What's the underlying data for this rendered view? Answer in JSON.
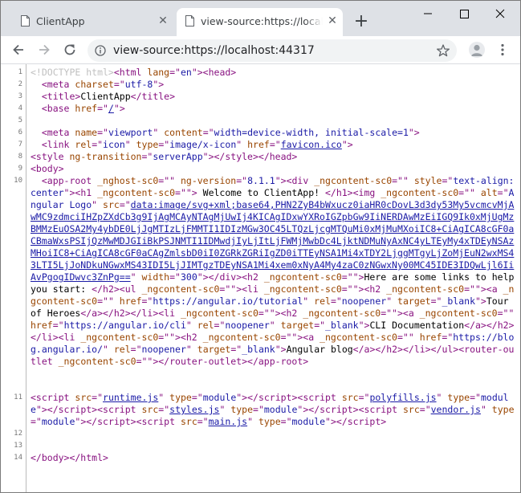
{
  "tabs": [
    {
      "title": "ClientApp",
      "active": false
    },
    {
      "title": "view-source:https://localhost",
      "active": true
    }
  ],
  "toolbar": {
    "url": "view-source:https://localhost:44317"
  },
  "source_lines": [
    {
      "num": "1",
      "html": "<span class=\"c-doc\">&lt;!DOCTYPE html&gt;</span><span class=\"c-tag\">&lt;html </span><span class=\"c-attr\">lang</span><span class=\"c-tag\">=\"</span><span class=\"c-val\">en</span><span class=\"c-tag\">\"&gt;&lt;head&gt;</span>"
    },
    {
      "num": "2",
      "html": "  <span class=\"c-tag\">&lt;meta </span><span class=\"c-attr\">charset</span><span class=\"c-tag\">=\"</span><span class=\"c-val\">utf-8</span><span class=\"c-tag\">\"&gt;</span>"
    },
    {
      "num": "3",
      "html": "  <span class=\"c-tag\">&lt;title&gt;</span>ClientApp<span class=\"c-tag\">&lt;/title&gt;</span>"
    },
    {
      "num": "4",
      "html": "  <span class=\"c-tag\">&lt;base </span><span class=\"c-attr\">href</span><span class=\"c-tag\">=\"</span><span class=\"c-link\">/</span><span class=\"c-tag\">\"&gt;</span>"
    },
    {
      "num": "5",
      "html": ""
    },
    {
      "num": "6",
      "html": "  <span class=\"c-tag\">&lt;meta </span><span class=\"c-attr\">name</span><span class=\"c-tag\">=\"</span><span class=\"c-val\">viewport</span><span class=\"c-tag\">\" </span><span class=\"c-attr\">content</span><span class=\"c-tag\">=\"</span><span class=\"c-val\">width=device-width, initial-scale=1</span><span class=\"c-tag\">\"&gt;</span>"
    },
    {
      "num": "7",
      "html": "  <span class=\"c-tag\">&lt;link </span><span class=\"c-attr\">rel</span><span class=\"c-tag\">=\"</span><span class=\"c-val\">icon</span><span class=\"c-tag\">\" </span><span class=\"c-attr\">type</span><span class=\"c-tag\">=\"</span><span class=\"c-val\">image/x-icon</span><span class=\"c-tag\">\" </span><span class=\"c-attr\">href</span><span class=\"c-tag\">=\"</span><span class=\"c-link\">favicon.ico</span><span class=\"c-tag\">\"&gt;</span>"
    },
    {
      "num": "8",
      "html": "<span class=\"c-tag\">&lt;style </span><span class=\"c-attr\">ng-transition</span><span class=\"c-tag\">=\"</span><span class=\"c-val\">serverApp</span><span class=\"c-tag\">\"&gt;&lt;/style&gt;&lt;/head&gt;</span>"
    },
    {
      "num": "9",
      "html": "<span class=\"c-tag\">&lt;body&gt;</span>"
    },
    {
      "num": "10",
      "html": "  <span class=\"c-tag\">&lt;app-root </span><span class=\"c-attr\">_nghost-sc0</span><span class=\"c-tag\">=\"\" </span><span class=\"c-attr\">ng-version</span><span class=\"c-tag\">=\"</span><span class=\"c-val\">8.1.1</span><span class=\"c-tag\">\"&gt;&lt;div </span><span class=\"c-attr\">_ngcontent-sc0</span><span class=\"c-tag\">=\"\" </span><span class=\"c-attr\">style</span><span class=\"c-tag\">=\"</span><span class=\"c-val\">text-align:center</span><span class=\"c-tag\">\"&gt;&lt;h1 </span><span class=\"c-attr\">_ngcontent-sc0</span><span class=\"c-tag\">=\"\"&gt;</span> Welcome to ClientApp! <span class=\"c-tag\">&lt;/h1&gt;&lt;img </span><span class=\"c-attr\">_ngcontent-sc0</span><span class=\"c-tag\">=\"\" </span><span class=\"c-attr\">alt</span><span class=\"c-tag\">=\"</span><span class=\"c-val\">Angular Logo</span><span class=\"c-tag\">\" </span><span class=\"c-attr\">src</span><span class=\"c-tag\">=\"</span><span class=\"c-link\">data:image/svg+xml;base64,PHN2ZyB4bWxucz0iaHR0cDovL3d3dy53My5vcmcvMjAwMC9zdmciIHZpZXdCb3g9IjAgMCAyNTAgMjUwIj4KICAgIDxwYXRoIGZpbGw9IiNERDAwMzEiIGQ9Ik0xMjUgMzBMMzEuOSA2My4ybDE0LjJgMTIzLjFMMTI1IDIzMGw3OC45LTQzLjcgMTQuMi0xMjMuMXoiIC8+CiAgICA8cGF0aCBmaWxsPSIjQzMwMDJGIiBkPSJNMTI1IDMwdjIyLjItLjFWMjMwbDc4LjktNDMuNyAxNC4yLTEyMy4xTDEyNSAzMHoiIC8+CiAgICA8cGF0aCAgZmlsbD0iI0ZGRkZGRiIgZD0iTTEyNSA1Mi4xTDY2LjggMTgyLjZoMjEuN2wxMS43LTI5LjJoNDkuNGwxMS43IDI5LjJIMTgzTDEyNSA1Mi4xem0xNyA4My4zaC0zNGwxNy00MC45IDE3IDQwLjl6IiAvPgogIDwvc3ZnPg==</span><span class=\"c-tag\">\" </span><span class=\"c-attr\">width</span><span class=\"c-tag\">=\"</span><span class=\"c-val\">300</span><span class=\"c-tag\">\"&gt;&lt;/div&gt;&lt;h2 </span><span class=\"c-attr\">_ngcontent-sc0</span><span class=\"c-tag\">=\"\"&gt;</span>Here are some links to help you start: <span class=\"c-tag\">&lt;/h2&gt;&lt;ul </span><span class=\"c-attr\">_ngcontent-sc0</span><span class=\"c-tag\">=\"\"&gt;&lt;li </span><span class=\"c-attr\">_ngcontent-sc0</span><span class=\"c-tag\">=\"\"&gt;&lt;h2 </span><span class=\"c-attr\">_ngcontent-sc0</span><span class=\"c-tag\">=\"\"&gt;&lt;a </span><span class=\"c-attr\">_ngcontent-sc0</span><span class=\"c-tag\">=\"\" </span><span class=\"c-attr\">href</span><span class=\"c-tag\">=\"</span><span class=\"c-val\">https://angular.io/tutorial</span><span class=\"c-tag\">\" </span><span class=\"c-attr\">rel</span><span class=\"c-tag\">=\"</span><span class=\"c-val\">noopener</span><span class=\"c-tag\">\" </span><span class=\"c-attr\">target</span><span class=\"c-tag\">=\"</span><span class=\"c-val\">_blank</span><span class=\"c-tag\">\"&gt;</span>Tour of Heroes<span class=\"c-tag\">&lt;/a&gt;&lt;/h2&gt;&lt;/li&gt;&lt;li </span><span class=\"c-attr\">_ngcontent-sc0</span><span class=\"c-tag\">=\"\"&gt;&lt;h2 </span><span class=\"c-attr\">_ngcontent-sc0</span><span class=\"c-tag\">=\"\"&gt;&lt;a </span><span class=\"c-attr\">_ngcontent-sc0</span><span class=\"c-tag\">=\"\" </span><span class=\"c-attr\">href</span><span class=\"c-tag\">=\"</span><span class=\"c-val\">https://angular.io/cli</span><span class=\"c-tag\">\" </span><span class=\"c-attr\">rel</span><span class=\"c-tag\">=\"</span><span class=\"c-val\">noopener</span><span class=\"c-tag\">\" </span><span class=\"c-attr\">target</span><span class=\"c-tag\">=\"</span><span class=\"c-val\">_blank</span><span class=\"c-tag\">\"&gt;</span>CLI Documentation<span class=\"c-tag\">&lt;/a&gt;&lt;/h2&gt;&lt;/li&gt;&lt;li </span><span class=\"c-attr\">_ngcontent-sc0</span><span class=\"c-tag\">=\"\"&gt;&lt;h2 </span><span class=\"c-attr\">_ngcontent-sc0</span><span class=\"c-tag\">=\"\"&gt;&lt;a </span><span class=\"c-attr\">_ngcontent-sc0</span><span class=\"c-tag\">=\"\" </span><span class=\"c-attr\">href</span><span class=\"c-tag\">=\"</span><span class=\"c-val\">https://blog.angular.io/</span><span class=\"c-tag\">\" </span><span class=\"c-attr\">rel</span><span class=\"c-tag\">=\"</span><span class=\"c-val\">noopener</span><span class=\"c-tag\">\" </span><span class=\"c-attr\">target</span><span class=\"c-tag\">=\"</span><span class=\"c-val\">_blank</span><span class=\"c-tag\">\"&gt;</span>Angular blog<span class=\"c-tag\">&lt;/a&gt;&lt;/h2&gt;&lt;/li&gt;&lt;/ul&gt;&lt;router-outlet </span><span class=\"c-attr\">_ngcontent-sc0</span><span class=\"c-tag\">=\"\"&gt;&lt;/router-outlet&gt;&lt;/app-root&gt;</span>"
    },
    {
      "num": "11",
      "html": "<span class=\"c-tag\">&lt;script </span><span class=\"c-attr\">src</span><span class=\"c-tag\">=\"</span><span class=\"c-link\">runtime.js</span><span class=\"c-tag\">\" </span><span class=\"c-attr\">type</span><span class=\"c-tag\">=\"</span><span class=\"c-val\">module</span><span class=\"c-tag\">\"&gt;&lt;/script&gt;&lt;script </span><span class=\"c-attr\">src</span><span class=\"c-tag\">=\"</span><span class=\"c-link\">polyfills.js</span><span class=\"c-tag\">\" </span><span class=\"c-attr\">type</span><span class=\"c-tag\">=\"</span><span class=\"c-val\">module</span><span class=\"c-tag\">\"&gt;&lt;/script&gt;&lt;script </span><span class=\"c-attr\">src</span><span class=\"c-tag\">=\"</span><span class=\"c-link\">styles.js</span><span class=\"c-tag\">\" </span><span class=\"c-attr\">type</span><span class=\"c-tag\">=\"</span><span class=\"c-val\">module</span><span class=\"c-tag\">\"&gt;&lt;/script&gt;&lt;script </span><span class=\"c-attr\">src</span><span class=\"c-tag\">=\"</span><span class=\"c-link\">vendor.js</span><span class=\"c-tag\">\" </span><span class=\"c-attr\">type</span><span class=\"c-tag\">=\"</span><span class=\"c-val\">module</span><span class=\"c-tag\">\"&gt;&lt;/script&gt;&lt;script </span><span class=\"c-attr\">src</span><span class=\"c-tag\">=\"</span><span class=\"c-link\">main.js</span><span class=\"c-tag\">\" </span><span class=\"c-attr\">type</span><span class=\"c-tag\">=\"</span><span class=\"c-val\">module</span><span class=\"c-tag\">\"&gt;&lt;/script&gt;</span>"
    },
    {
      "num": "12",
      "html": ""
    },
    {
      "num": "13",
      "html": ""
    },
    {
      "num": "14",
      "html": "<span class=\"c-tag\">&lt;/body&gt;&lt;/html&gt;</span>"
    }
  ]
}
